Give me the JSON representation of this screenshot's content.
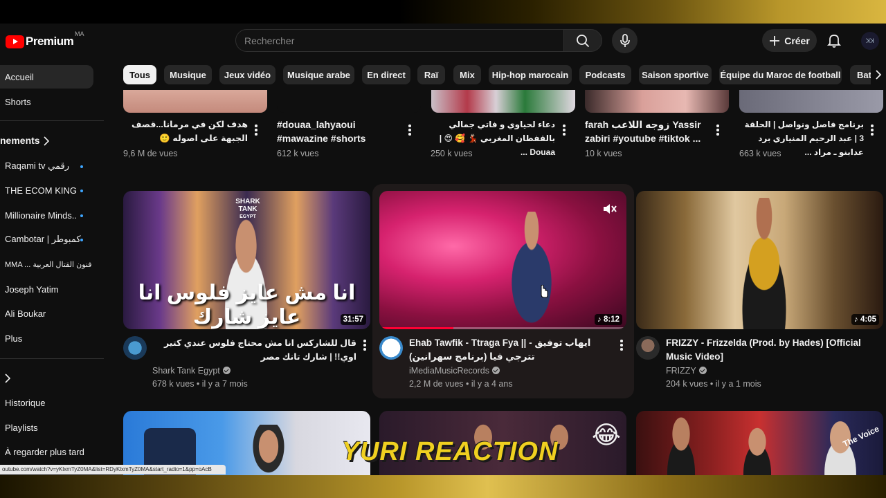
{
  "header": {
    "logo_text": "Premium",
    "country_code": "MA",
    "search_placeholder": "Rechercher",
    "create_label": "Créer",
    "account_badge": "ꓘꓘ"
  },
  "chips": [
    "Tous",
    "Musique",
    "Jeux vidéo",
    "Musique arabe",
    "En direct",
    "Raï",
    "Mix",
    "Hip-hop marocain",
    "Podcasts",
    "Saison sportive",
    "Équipe du Maroc de football",
    "Bat"
  ],
  "sidebar": {
    "home": "Accueil",
    "shorts": "Shorts",
    "subscriptions": "nements",
    "channels": [
      "Raqami tv رقمي",
      "THE ECOM KING",
      "Millionaire Minds...",
      "Cambotar | كمبوطر",
      "MMA ... فنون القتال العربية",
      "Joseph Yatim",
      "Ali Boukar"
    ],
    "more": "Plus",
    "history": "Historique",
    "playlists": "Playlists",
    "watch_later": "À regarder plus tard"
  },
  "shorts": [
    {
      "title": "هدف لكن في مرمانا...قصف الجبهة على اصوله 🙂",
      "views": "9,6 M de vues"
    },
    {
      "title": "#douaa_lahyaoui #mawazine #shorts",
      "views": "612 k vues"
    },
    {
      "title": "دعاء لحياوي و فاتي جمالي بالقفطان المغربي 💃🏻 🥰 😍 | Douaa ...",
      "views": "250 k vues"
    },
    {
      "title": "farah زوجه اللاعب Yassir zabiri #youtube #tiktok ...",
      "views": "10 k vues"
    },
    {
      "title": "برنامج فاصل ونواصل | الحلقة 3 | عبد الرحيم المنياري برد عدابنو ـ مراد ...",
      "views": "663 k vues"
    }
  ],
  "videos": [
    {
      "thumb_text": "انا مش عايز فلوس انا عايز شارك",
      "thumb_brand": "SHARK TANK",
      "thumb_brand_sub": "EGYPT",
      "duration": "31:57",
      "title": "قال للشاركس انا مش محتاج فلوس عندي كتير اوي!! | شارك تانك مصر",
      "channel": "Shark Tank Egypt",
      "stats": "678 k vues • il y a 7 mois"
    },
    {
      "duration": "♪ 8:12",
      "title": "Ehab Tawfik - Ttraga Fya || ايهاب توفيق - تترجي فيا (برنامج سهرانين)",
      "channel": "iMediaMusicRecords",
      "stats": "2,2 M de vues • il y a 4 ans"
    },
    {
      "duration": "♪ 4:05",
      "title": "FRIZZY - Frizzelda (Prod. by Hades) [Official Music Video]",
      "channel": "FRIZZY",
      "stats": "204 k vues • il y a 1 mois"
    }
  ],
  "row3": {
    "overlay_text": "YURI REACTION",
    "emoji": "😂",
    "small_text": "The Voice"
  },
  "url_tooltip": "outube.com/watch?v=yKlxmTyZ0MA&list=RDyKlxmTyZ0MA&start_radio=1&pp=oAcB",
  "colors": {
    "brand": "#ff0000",
    "background": "#0f0f0f",
    "chip": "#272727",
    "gold": "#d9b640"
  }
}
